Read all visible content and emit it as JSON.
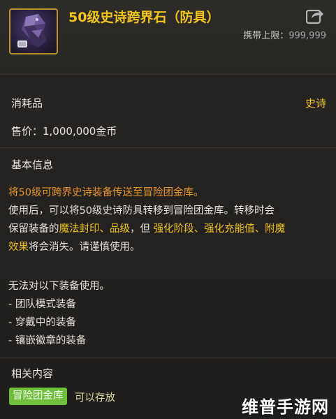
{
  "item": {
    "title": "50级史诗跨界石（防具）",
    "icon": "epic-crystal-icon",
    "carry_limit_label": "携带上限：",
    "carry_limit_value": "999,999",
    "type": "消耗品",
    "rarity": "史诗",
    "price": "售价：1,000,000金币"
  },
  "basic_info": {
    "title": "基本信息",
    "line1": "将50级可跨界史诗装备传送至冒险团金库。",
    "line2": "使用后，可以将50级史诗防具转移到冒险团金库。转移时会",
    "line3_a": "保留装备的",
    "line3_b": "魔法封印、品级",
    "line3_c": "，但 ",
    "line3_d": "强化阶段、强化充能值、附魔",
    "line4_a": "效果",
    "line4_b": "将会消失。请谨慎使用。"
  },
  "restrictions": {
    "title": "无法对以下装备使用。",
    "items": [
      "- 团队模式装备",
      "- 穿戴中的装备",
      "- 镶嵌徽章的装备"
    ]
  },
  "related": {
    "title": "相关内容",
    "badge": "冒险团金库",
    "status": "可以存放"
  },
  "watermark": "维普手游网",
  "colors": {
    "title_gold": "#f0c41c",
    "highlight_orange": "#e8962c",
    "badge_green": "#6fbf3c"
  }
}
